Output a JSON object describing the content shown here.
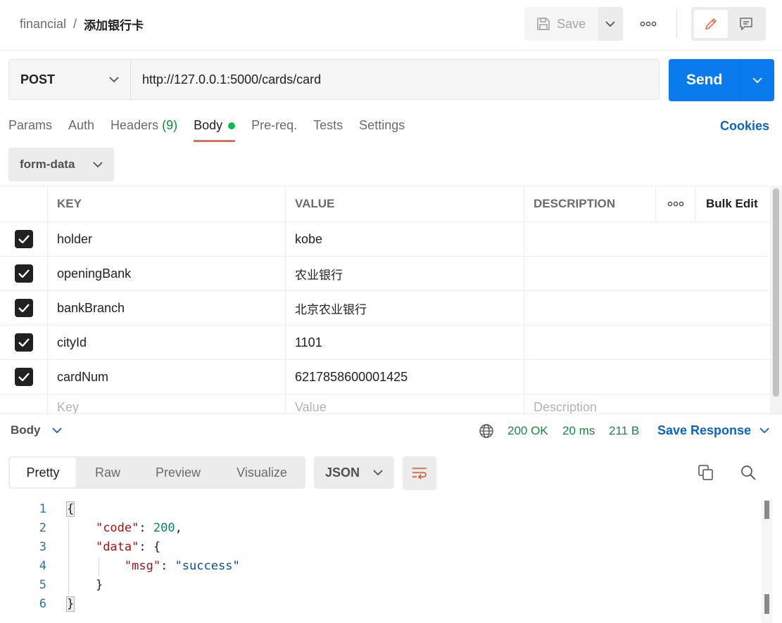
{
  "header": {
    "collection": "financial",
    "separator": "/",
    "request_name": "添加银行卡",
    "save_label": "Save"
  },
  "request": {
    "method": "POST",
    "url": "http://127.0.0.1:5000/cards/card",
    "send_label": "Send"
  },
  "tabs": [
    {
      "label": "Params"
    },
    {
      "label": "Auth"
    },
    {
      "label": "Headers",
      "count": "(9)"
    },
    {
      "label": "Body",
      "active": true
    },
    {
      "label": "Pre-req."
    },
    {
      "label": "Tests"
    },
    {
      "label": "Settings"
    }
  ],
  "cookies_label": "Cookies",
  "body_type": "form-data",
  "table": {
    "headers": {
      "key": "KEY",
      "value": "VALUE",
      "description": "DESCRIPTION",
      "bulk_edit": "Bulk Edit"
    },
    "rows": [
      {
        "key": "holder",
        "value": "kobe",
        "checked": true
      },
      {
        "key": "openingBank",
        "value": "农业银行",
        "checked": true
      },
      {
        "key": "bankBranch",
        "value": "北京农业银行",
        "checked": true
      },
      {
        "key": "cityId",
        "value": "1101",
        "checked": true
      },
      {
        "key": "cardNum",
        "value": "6217858600001425",
        "checked": true
      }
    ],
    "placeholders": {
      "key": "Key",
      "value": "Value",
      "description": "Description"
    }
  },
  "response": {
    "section_label": "Body",
    "status": "200 OK",
    "time": "20 ms",
    "size": "211 B",
    "save_response_label": "Save Response",
    "view_tabs": [
      "Pretty",
      "Raw",
      "Preview",
      "Visualize"
    ],
    "active_view": "Pretty",
    "format": "JSON",
    "line_numbers": [
      "1",
      "2",
      "3",
      "4",
      "5",
      "6"
    ],
    "code": {
      "open": "{",
      "code_key": "\"code\"",
      "code_value": "200",
      "data_key": "\"data\"",
      "msg_key": "\"msg\"",
      "msg_value": "\"success\"",
      "inner_close": "}",
      "close": "}"
    }
  },
  "colors": {
    "accent": "#097bed",
    "active_tab_underline": "#f26b3a",
    "status_green": "#0f8a3e",
    "link_blue": "#0a65c7"
  }
}
